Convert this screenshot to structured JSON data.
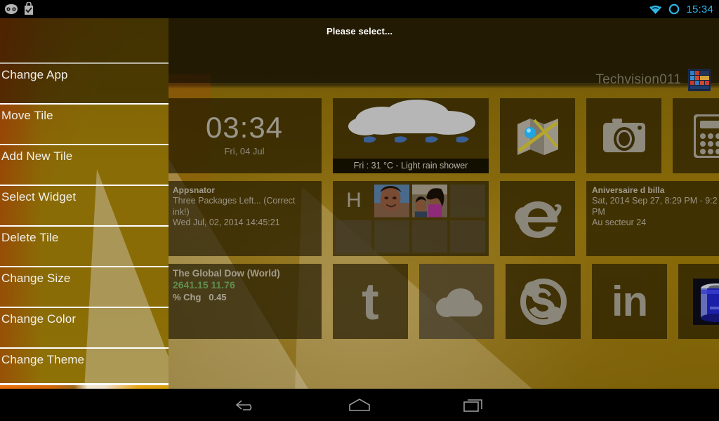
{
  "statusbar": {
    "left_icons": [
      {
        "name": "cyanogenmod-icon"
      },
      {
        "name": "shopping-bag-check-icon"
      }
    ],
    "right_icons": [
      {
        "name": "wifi-icon"
      },
      {
        "name": "circle-indicator-icon"
      }
    ],
    "clock": "15:34",
    "accent_color": "#2eb7e8"
  },
  "header": {
    "title": "Please select...",
    "brand_name": "Techvision011",
    "brand_icon": "tile-grid-app-icon"
  },
  "menu": {
    "items": [
      {
        "label": "Change App"
      },
      {
        "label": "Move Tile"
      },
      {
        "label": "Add New Tile"
      },
      {
        "label": "Select Widget"
      },
      {
        "label": "Delete Tile"
      },
      {
        "label": "Change Size"
      },
      {
        "label": "Change Color"
      },
      {
        "label": "Change Theme"
      }
    ]
  },
  "tiles": {
    "clock": {
      "time": "03:34",
      "date": "Fri, 04 Jul"
    },
    "weather": {
      "caption": "Fri : 31 °C - Light rain shower",
      "icon": "rain-cloud-icon"
    },
    "maps": {
      "icon": "maps-icon"
    },
    "camera": {
      "icon": "camera-icon"
    },
    "calculator": {
      "icon": "calculator-icon"
    },
    "appsnator": {
      "title": "Appsnator",
      "line1": "Three Packages Left... (Correct",
      "line2": "ink!)",
      "line3": "Wed Jul, 02, 2014 14:45:21"
    },
    "gallery": {
      "letter": "H",
      "cells": 8
    },
    "browser": {
      "icon": "internet-explorer-icon"
    },
    "calendar": {
      "title": "Aniversaire d billa",
      "line1": "Sat, 2014 Sep 27, 8:29 PM - 9:2",
      "line2": "PM",
      "line3": "Au secteur 24"
    },
    "stocks": {
      "title": "The Global Dow (World)",
      "value": "2641.15 11.76",
      "change_label": "% Chg",
      "change_value": "0.45",
      "value_color": "#5f8f4e"
    },
    "tumblr": {
      "icon": "tumblr-icon",
      "glyph": "t"
    },
    "cloud": {
      "icon": "onedrive-cloud-icon"
    },
    "skype": {
      "icon": "skype-icon",
      "glyph": "S"
    },
    "linkedin": {
      "icon": "linkedin-icon",
      "glyph": "in"
    },
    "battery": {
      "icon": "battery-icon"
    }
  },
  "navbar": {
    "back": "back-button",
    "home": "home-button",
    "recent": "recent-apps-button"
  }
}
